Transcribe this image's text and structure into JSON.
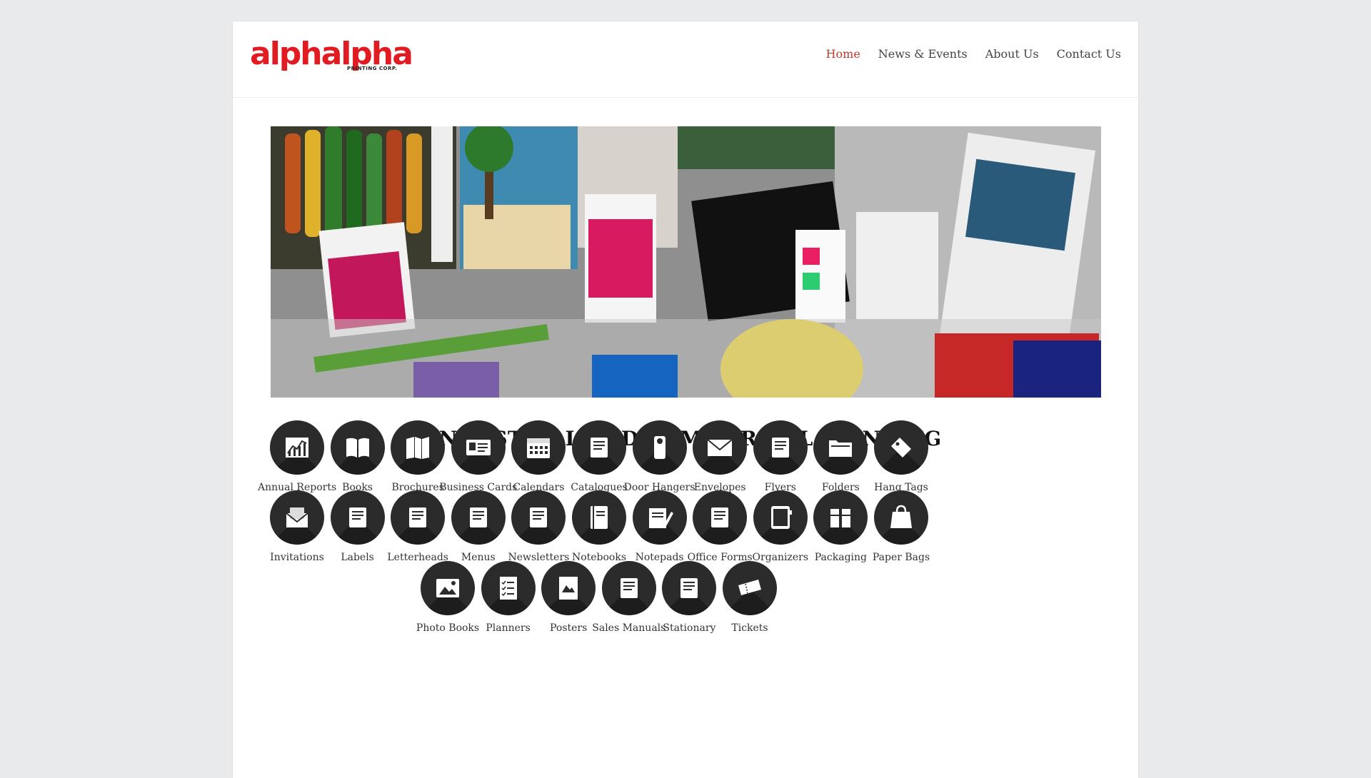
{
  "logo": {
    "word_a": "alph",
    "word_b": "alpha",
    "subtitle": "PRINTING CORP."
  },
  "nav": [
    {
      "label": "Home",
      "active": true
    },
    {
      "label": "News & Events",
      "active": false
    },
    {
      "label": "About Us",
      "active": false
    },
    {
      "label": "Contact Us",
      "active": false
    }
  ],
  "main": {
    "heading": "INDUSTRIAL AND COMMERCIAL PRINTING"
  },
  "categories_row1": [
    "Annual Reports",
    "Books",
    "Brochures",
    "Business Cards",
    "Calendars",
    "Catalogues",
    "Door Hangers",
    "Envelopes",
    "Flyers",
    "Folders",
    "Hang Tags"
  ],
  "categories_row2": [
    "Invitations",
    "Labels",
    "Letterheads",
    "Menus",
    "Newsletters",
    "Notebooks",
    "Notepads",
    "Office Forms",
    "Organizers",
    "Packaging",
    "Paper Bags"
  ],
  "categories_row3": [
    "Photo Books",
    "Planners",
    "Posters",
    "Sales Manuals",
    "Stationary",
    "Tickets"
  ],
  "icons_row1": [
    "chart-icon",
    "book-icon",
    "brochure-icon",
    "business-card-icon",
    "calendar-icon",
    "catalogue-icon",
    "door-hanger-icon",
    "envelope-icon",
    "flyer-icon",
    "folder-icon",
    "tag-icon"
  ],
  "icons_row2": [
    "invitation-icon",
    "label-icon",
    "letterhead-icon",
    "menu-icon",
    "newsletter-icon",
    "notebook-icon",
    "notepad-icon",
    "office-form-icon",
    "organizer-icon",
    "packaging-icon",
    "paper-bag-icon"
  ],
  "icons_row3": [
    "photo-book-icon",
    "planner-icon",
    "poster-icon",
    "sales-manual-icon",
    "stationary-icon",
    "ticket-icon"
  ],
  "colors": {
    "brand_red": "#e11b22",
    "nav_active": "#c0392b",
    "icon_bg": "#2b2b2b"
  }
}
